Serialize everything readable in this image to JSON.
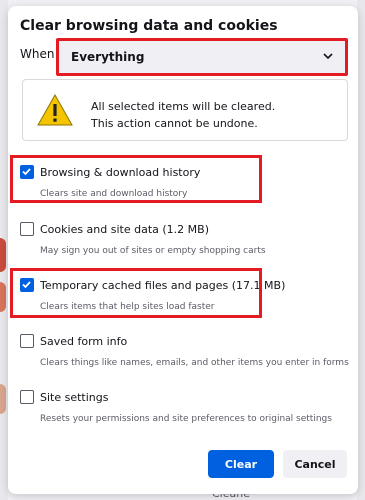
{
  "dialog": {
    "title": "Clear browsing data and cookies",
    "when_label": "When",
    "when_value": "Everything",
    "warning_line1": "All selected items will be cleared.",
    "warning_line2": "This action cannot be undone."
  },
  "items": [
    {
      "label": "Browsing & download history",
      "desc": "Clears site and download history",
      "checked": true
    },
    {
      "label": "Cookies and site data (1.2 MB)",
      "desc": "May sign you out of sites or empty shopping carts",
      "checked": false
    },
    {
      "label": "Temporary cached files and pages (17.1 MB)",
      "desc": "Clears items that help sites load faster",
      "checked": true
    },
    {
      "label": "Saved form info",
      "desc": "Clears things like names, emails, and other items you enter in forms",
      "checked": false
    },
    {
      "label": "Site settings",
      "desc": "Resets your permissions and site preferences to original settings",
      "checked": false
    }
  ],
  "buttons": {
    "clear": "Clear",
    "cancel": "Cancel"
  },
  "background_text": "Cleane",
  "colors": {
    "accent": "#0061e0",
    "highlight": "#e31b23"
  }
}
